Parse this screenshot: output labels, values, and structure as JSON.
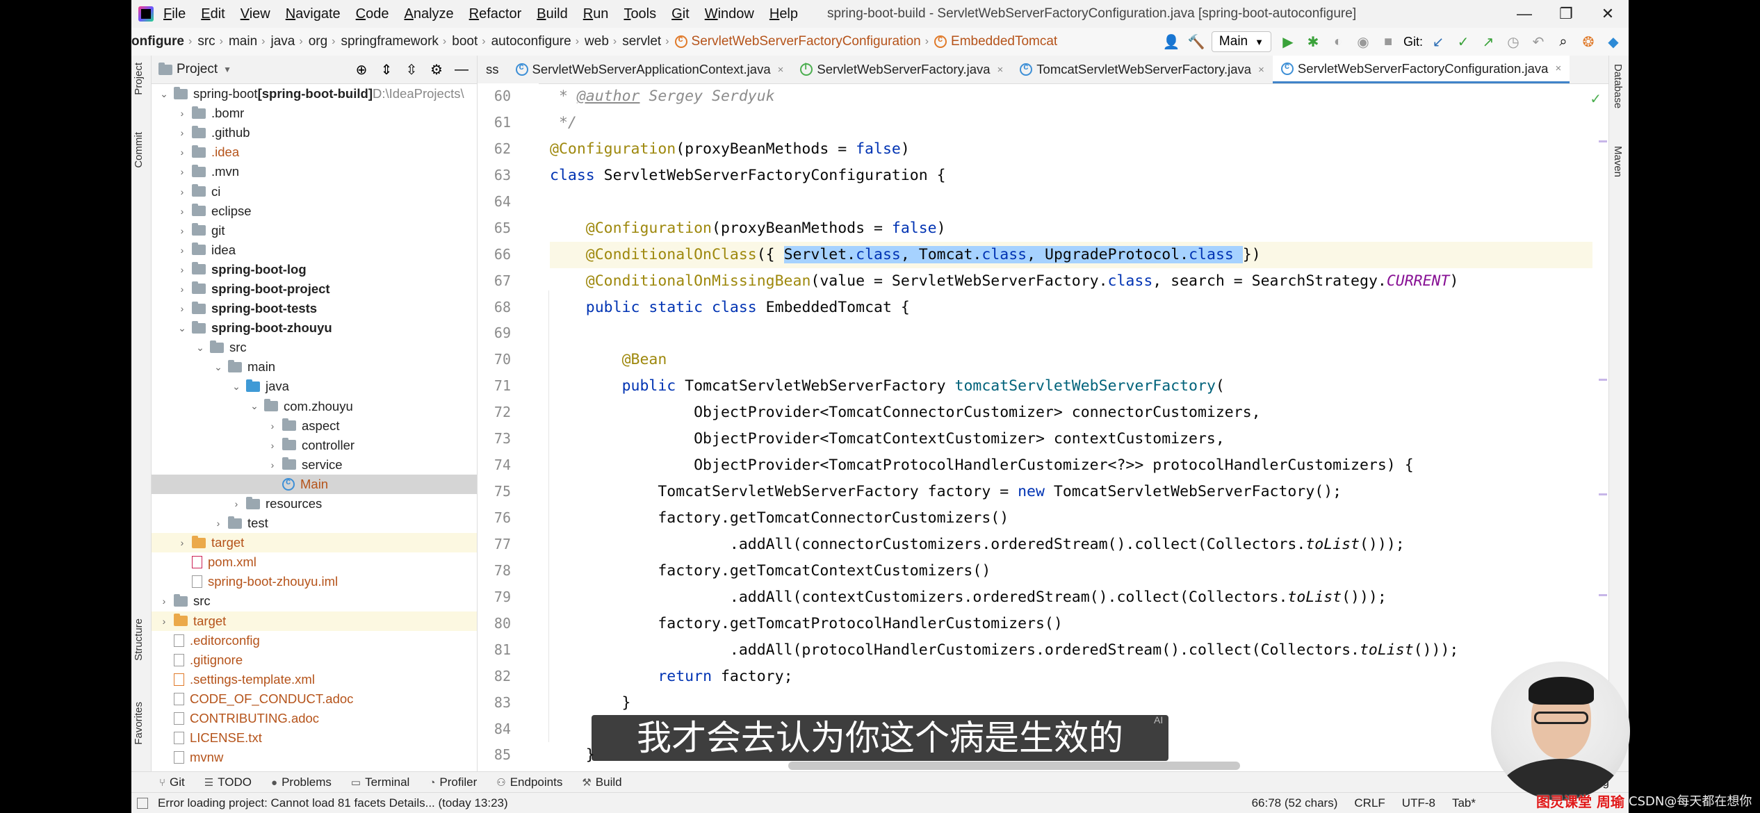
{
  "window": {
    "menu": [
      "File",
      "Edit",
      "View",
      "Navigate",
      "Code",
      "Analyze",
      "Refactor",
      "Build",
      "Run",
      "Tools",
      "Git",
      "Window",
      "Help"
    ],
    "title": "spring-boot-build - ServletWebServerFactoryConfiguration.java [spring-boot-autoconfigure]",
    "minimize": "—",
    "maximize": "❐",
    "close": "✕"
  },
  "navbar": {
    "crumbs": [
      "onfigure",
      "src",
      "main",
      "java",
      "org",
      "springframework",
      "boot",
      "autoconfigure",
      "web",
      "servlet"
    ],
    "class_crumb": "ServletWebServerFactoryConfiguration",
    "inner_crumb": "EmbeddedTomcat",
    "run_config": "Main",
    "git_label": "Git:"
  },
  "side_tabs": {
    "left": [
      "Project",
      "Commit",
      "Structure",
      "Favorites"
    ],
    "right": [
      "Database",
      "Maven"
    ]
  },
  "project": {
    "title": "Project",
    "tree": [
      {
        "indent": 0,
        "chev": "v",
        "icon": "folder",
        "text": "spring-boot",
        "extra": " [spring-boot-build]",
        "extra_bold": true,
        "path": " D:\\IdeaProjects\\"
      },
      {
        "indent": 1,
        "chev": ">",
        "icon": "folder",
        "text": ".bomr"
      },
      {
        "indent": 1,
        "chev": ">",
        "icon": "folder",
        "text": ".github"
      },
      {
        "indent": 1,
        "chev": ">",
        "icon": "folder",
        "text": ".idea",
        "cls": "orange-t"
      },
      {
        "indent": 1,
        "chev": ">",
        "icon": "folder",
        "text": ".mvn"
      },
      {
        "indent": 1,
        "chev": ">",
        "icon": "folder",
        "text": "ci"
      },
      {
        "indent": 1,
        "chev": ">",
        "icon": "folder",
        "text": "eclipse"
      },
      {
        "indent": 1,
        "chev": ">",
        "icon": "folder",
        "text": "git"
      },
      {
        "indent": 1,
        "chev": ">",
        "icon": "folder",
        "text": "idea"
      },
      {
        "indent": 1,
        "chev": ">",
        "icon": "folder",
        "text": "spring-boot-log",
        "cls": "bold"
      },
      {
        "indent": 1,
        "chev": ">",
        "icon": "folder",
        "text": "spring-boot-project",
        "cls": "bold"
      },
      {
        "indent": 1,
        "chev": ">",
        "icon": "folder",
        "text": "spring-boot-tests",
        "cls": "bold"
      },
      {
        "indent": 1,
        "chev": "v",
        "icon": "folder",
        "text": "spring-boot-zhouyu",
        "cls": "bold"
      },
      {
        "indent": 2,
        "chev": "v",
        "icon": "folder",
        "text": "src"
      },
      {
        "indent": 3,
        "chev": "v",
        "icon": "folder",
        "text": "main"
      },
      {
        "indent": 4,
        "chev": "v",
        "icon": "folder blue",
        "text": "java"
      },
      {
        "indent": 5,
        "chev": "v",
        "icon": "folder",
        "text": "com.zhouyu"
      },
      {
        "indent": 6,
        "chev": ">",
        "icon": "folder",
        "text": "aspect"
      },
      {
        "indent": 6,
        "chev": ">",
        "icon": "folder",
        "text": "controller"
      },
      {
        "indent": 6,
        "chev": ">",
        "icon": "folder",
        "text": "service"
      },
      {
        "indent": 6,
        "chev": "",
        "icon": "class",
        "text": "Main",
        "cls": "orange-t",
        "row": "selected"
      },
      {
        "indent": 4,
        "chev": ">",
        "icon": "folder",
        "text": "resources"
      },
      {
        "indent": 3,
        "chev": ">",
        "icon": "folder",
        "text": "test"
      },
      {
        "indent": 1,
        "chev": ">",
        "icon": "folder orange",
        "text": "target",
        "cls": "orange-t",
        "row": "hl"
      },
      {
        "indent": 1,
        "chev": "",
        "icon": "file m",
        "text": "pom.xml",
        "cls": "orange-t"
      },
      {
        "indent": 1,
        "chev": "",
        "icon": "file",
        "text": "spring-boot-zhouyu.iml",
        "cls": "orange-t"
      },
      {
        "indent": 0,
        "chev": ">",
        "icon": "folder",
        "text": "src"
      },
      {
        "indent": 0,
        "chev": ">",
        "icon": "folder orange",
        "text": "target",
        "cls": "orange-t",
        "row": "hl"
      },
      {
        "indent": 0,
        "chev": "",
        "icon": "file",
        "text": ".editorconfig",
        "cls": "orange-t"
      },
      {
        "indent": 0,
        "chev": "",
        "icon": "file",
        "text": ".gitignore",
        "cls": "orange-t"
      },
      {
        "indent": 0,
        "chev": "",
        "icon": "file x",
        "text": ".settings-template.xml",
        "cls": "orange-t"
      },
      {
        "indent": 0,
        "chev": "",
        "icon": "file",
        "text": "CODE_OF_CONDUCT.adoc",
        "cls": "orange-t"
      },
      {
        "indent": 0,
        "chev": "",
        "icon": "file",
        "text": "CONTRIBUTING.adoc",
        "cls": "orange-t"
      },
      {
        "indent": 0,
        "chev": "",
        "icon": "file",
        "text": "LICENSE.txt",
        "cls": "orange-t"
      },
      {
        "indent": 0,
        "chev": "",
        "icon": "file",
        "text": "mvnw",
        "cls": "orange-t"
      }
    ]
  },
  "editor": {
    "tabs": [
      {
        "label": "ss",
        "icon": "",
        "active": false
      },
      {
        "label": "ServletWebServerApplicationContext.java",
        "icon": "c",
        "active": false
      },
      {
        "label": "ServletWebServerFactory.java",
        "icon": "i",
        "active": false
      },
      {
        "label": "TomcatServletWebServerFactory.java",
        "icon": "c",
        "active": false
      },
      {
        "label": "ServletWebServerFactoryConfiguration.java",
        "icon": "c",
        "active": true
      }
    ],
    "tab_close": "×",
    "line_numbers": [
      "60",
      "61",
      "62",
      "63",
      "64",
      "65",
      "66",
      "67",
      "68",
      "69",
      "70",
      "71",
      "72",
      "73",
      "74",
      "75",
      "76",
      "77",
      "78",
      "79",
      "80",
      "81",
      "82",
      "83",
      "84",
      "85"
    ],
    "caret_line_index": 6,
    "lines": [
      [
        [
          "cmt",
          " * "
        ],
        [
          "doc-tag",
          "@author"
        ],
        [
          "cmt",
          " Sergey Serdyuk"
        ]
      ],
      [
        [
          "cmt",
          " */"
        ]
      ],
      [
        [
          "ann",
          "@Configuration"
        ],
        [
          "",
          "(proxyBeanMethods = "
        ],
        [
          "kw",
          "false"
        ],
        [
          "",
          ")"
        ]
      ],
      [
        [
          "kw",
          "class"
        ],
        [
          "",
          " ServletWebServerFactoryConfiguration {"
        ]
      ],
      [],
      [
        [
          "",
          "    "
        ],
        [
          "ann",
          "@Configuration"
        ],
        [
          "",
          "(proxyBeanMethods = "
        ],
        [
          "kw",
          "false"
        ],
        [
          "",
          ")"
        ]
      ],
      [
        [
          "",
          "    "
        ],
        [
          "ann",
          "@ConditionalOnClass"
        ],
        [
          "",
          "({ "
        ],
        [
          "sel",
          "Servlet."
        ],
        [
          "sel kw",
          "class"
        ],
        [
          "sel",
          ", Tomcat."
        ],
        [
          "sel kw",
          "class"
        ],
        [
          "sel",
          ", UpgradeProtocol."
        ],
        [
          "sel kw",
          "class"
        ],
        [
          "sel",
          " "
        ],
        [
          "",
          "})"
        ]
      ],
      [
        [
          "",
          "    "
        ],
        [
          "ann",
          "@ConditionalOnMissingBean"
        ],
        [
          "",
          "(value = ServletWebServerFactory."
        ],
        [
          "kw",
          "class"
        ],
        [
          "",
          ", search = SearchStrategy."
        ],
        [
          "fld",
          "CURRENT"
        ],
        [
          "",
          ")"
        ]
      ],
      [
        [
          "",
          "    "
        ],
        [
          "kw",
          "public static class"
        ],
        [
          "",
          " EmbeddedTomcat {"
        ]
      ],
      [],
      [
        [
          "",
          "        "
        ],
        [
          "ann",
          "@Bean"
        ]
      ],
      [
        [
          "",
          "        "
        ],
        [
          "kw",
          "public"
        ],
        [
          "",
          " TomcatServletWebServerFactory "
        ],
        [
          "mth",
          "tomcatServletWebServerFactory"
        ],
        [
          "",
          "("
        ]
      ],
      [
        [
          "",
          "                ObjectProvider<TomcatConnectorCustomizer> connectorCustomizers,"
        ]
      ],
      [
        [
          "",
          "                ObjectProvider<TomcatContextCustomizer> contextCustomizers,"
        ]
      ],
      [
        [
          "",
          "                ObjectProvider<TomcatProtocolHandlerCustomizer<?>> protocolHandlerCustomizers) {"
        ]
      ],
      [
        [
          "",
          "            TomcatServletWebServerFactory factory = "
        ],
        [
          "kw",
          "new"
        ],
        [
          "",
          " TomcatServletWebServerFactory();"
        ]
      ],
      [
        [
          "",
          "            factory.getTomcatConnectorCustomizers()"
        ]
      ],
      [
        [
          "",
          "                    .addAll(connectorCustomizers.orderedStream().collect(Collectors."
        ],
        [
          "it",
          "toList"
        ],
        [
          "",
          "()));"
        ]
      ],
      [
        [
          "",
          "            factory.getTomcatContextCustomizers()"
        ]
      ],
      [
        [
          "",
          "                    .addAll(contextCustomizers.orderedStream().collect(Collectors."
        ],
        [
          "it",
          "toList"
        ],
        [
          "",
          "()));"
        ]
      ],
      [
        [
          "",
          "            factory.getTomcatProtocolHandlerCustomizers()"
        ]
      ],
      [
        [
          "",
          "                    .addAll(protocolHandlerCustomizers.orderedStream().collect(Collectors."
        ],
        [
          "it",
          "toList"
        ],
        [
          "",
          "()));"
        ]
      ],
      [
        [
          "",
          "            "
        ],
        [
          "kw",
          "return"
        ],
        [
          "",
          " factory;"
        ]
      ],
      [
        [
          "",
          "        }"
        ]
      ],
      [],
      [
        [
          "",
          "    }"
        ]
      ]
    ]
  },
  "bottom_tools": [
    {
      "icon": "⑂",
      "label": "Git"
    },
    {
      "icon": "☰",
      "label": "TODO"
    },
    {
      "icon": "●",
      "label": "Problems"
    },
    {
      "icon": "▭",
      "label": "Terminal"
    },
    {
      "icon": "◔",
      "label": "Profiler"
    },
    {
      "icon": "⚇",
      "label": "Endpoints"
    },
    {
      "icon": "⚒",
      "label": "Build"
    }
  ],
  "status": {
    "message": "Error loading project: Cannot load 81 facets Details... (today 13:23)",
    "position": "66:78 (52 chars)",
    "line_sep": "CRLF",
    "encoding": "UTF-8",
    "indent": "Tab*",
    "log": "og"
  },
  "subtitle": "我才会去认为你这个病是生效的",
  "ai_badge": "AI",
  "watermark": "图灵课堂 周瑜",
  "csdn": "CSDN@每天都在想你"
}
